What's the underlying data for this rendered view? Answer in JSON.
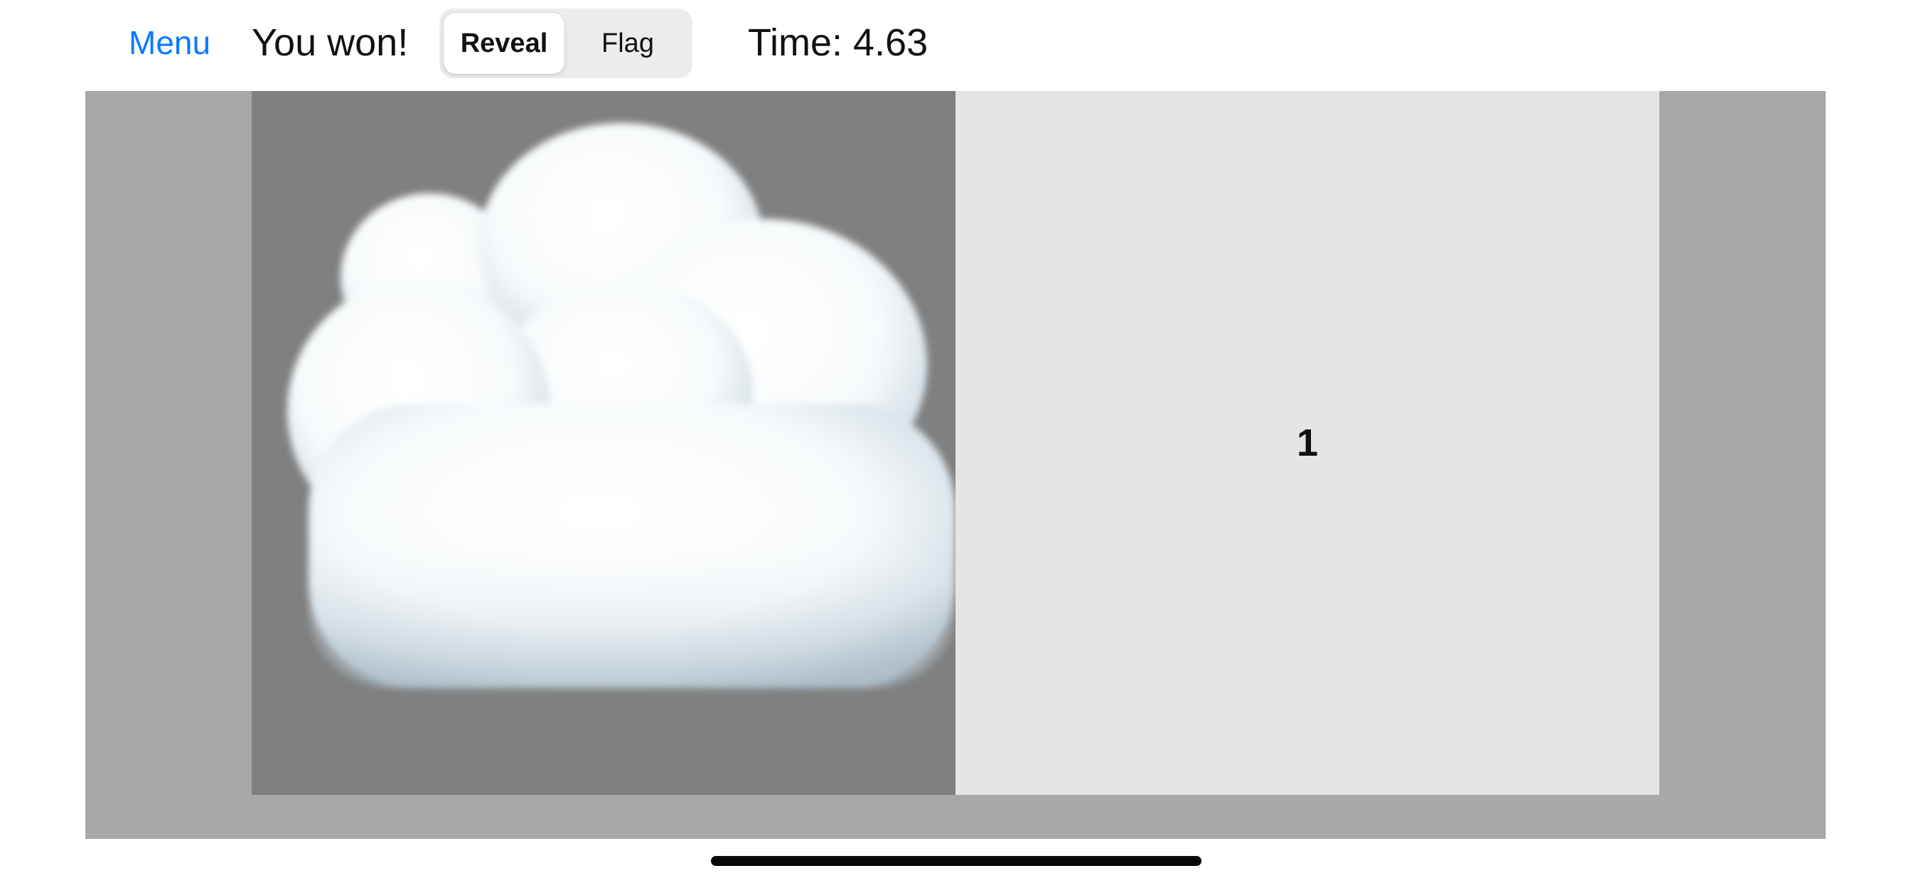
{
  "toolbar": {
    "menu_label": "Menu",
    "status": "You won!",
    "modes": [
      {
        "label": "Reveal",
        "selected": true
      },
      {
        "label": "Flag",
        "selected": false
      }
    ],
    "timer": "Time: 4.63"
  },
  "board": {
    "cells": [
      {
        "icon": "cloud-icon",
        "revealed": true
      },
      {
        "number": "1",
        "revealed": true
      }
    ]
  },
  "colors": {
    "menu_link": "#0a7aff",
    "board_frame": "#a8a8a8",
    "cloud_cell_background": "#808080",
    "revealed_cell_background": "#e5e5e5"
  }
}
